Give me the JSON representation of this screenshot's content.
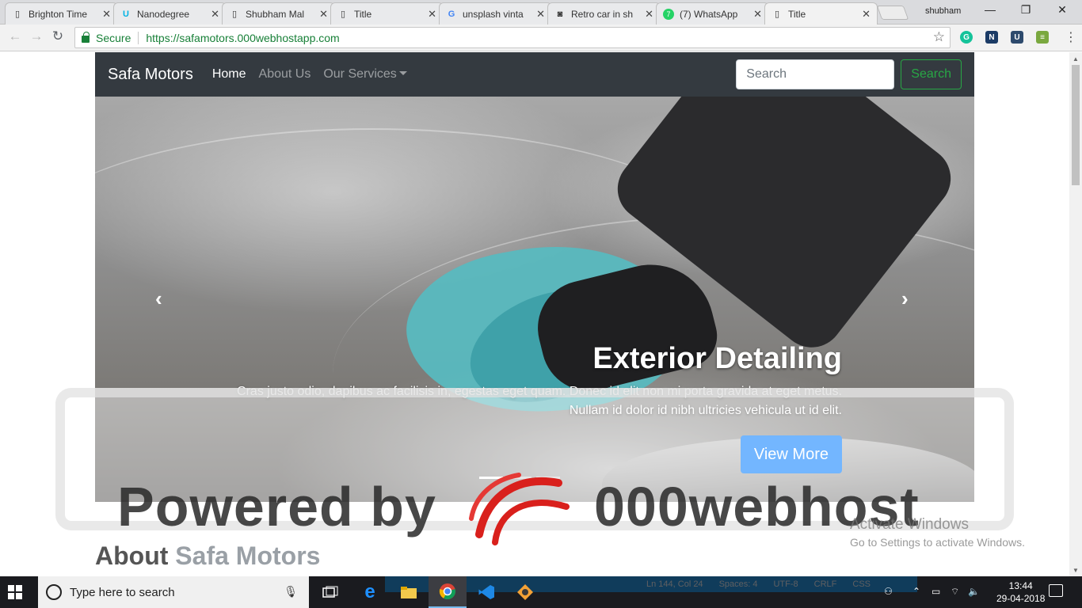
{
  "browser": {
    "tabs": [
      {
        "title": "Brighton Time",
        "icon": "page-icon"
      },
      {
        "title": "Nanodegree",
        "icon": "udacity-icon"
      },
      {
        "title": "Shubham Mal",
        "icon": "page-icon"
      },
      {
        "title": "Title",
        "icon": "page-icon"
      },
      {
        "title": "unsplash vinta",
        "icon": "google-icon"
      },
      {
        "title": "Retro car in sh",
        "icon": "camera-icon"
      },
      {
        "title": "(7) WhatsApp",
        "icon": "whatsapp-icon"
      },
      {
        "title": "Title",
        "icon": "page-icon",
        "active": true
      }
    ],
    "profile_name": "shubham",
    "secure_label": "Secure",
    "url": "https://safamotors.000webhostapp.com"
  },
  "site": {
    "brand": "Safa Motors",
    "nav": {
      "home": "Home",
      "about": "About Us",
      "services": "Our Services"
    },
    "search": {
      "placeholder": "Search",
      "button": "Search"
    },
    "slide": {
      "title": "Exterior Detailing",
      "text_line1": "Cras justo odio, dapibus ac facilisis in, egestas eget quam. Donec id elit non mi porta gravida at eget metus.",
      "text_line2": "Nullam id dolor id nibh ultricies vehicula ut id elit.",
      "button": "View More",
      "indicators": 3,
      "active_indicator": 1
    },
    "about_heading": {
      "prefix": "About",
      "highlight": "Safa Motors"
    }
  },
  "watermark": {
    "powered_by": "Powered by",
    "brand": "000webhost"
  },
  "activation": {
    "line1": "Activate Windows",
    "line2": "Go to Settings to activate Windows."
  },
  "taskbar": {
    "search_placeholder": "Type here to search",
    "time": "13:44",
    "date": "29-04-2018",
    "editor_status": [
      "Ln 144, Col 24",
      "Spaces: 4",
      "UTF-8",
      "CRLF",
      "CSS"
    ]
  },
  "colors": {
    "navbar": "#343a40",
    "success": "#28a745",
    "primary": "#007bff",
    "taskbar": "#1a1b1f"
  }
}
